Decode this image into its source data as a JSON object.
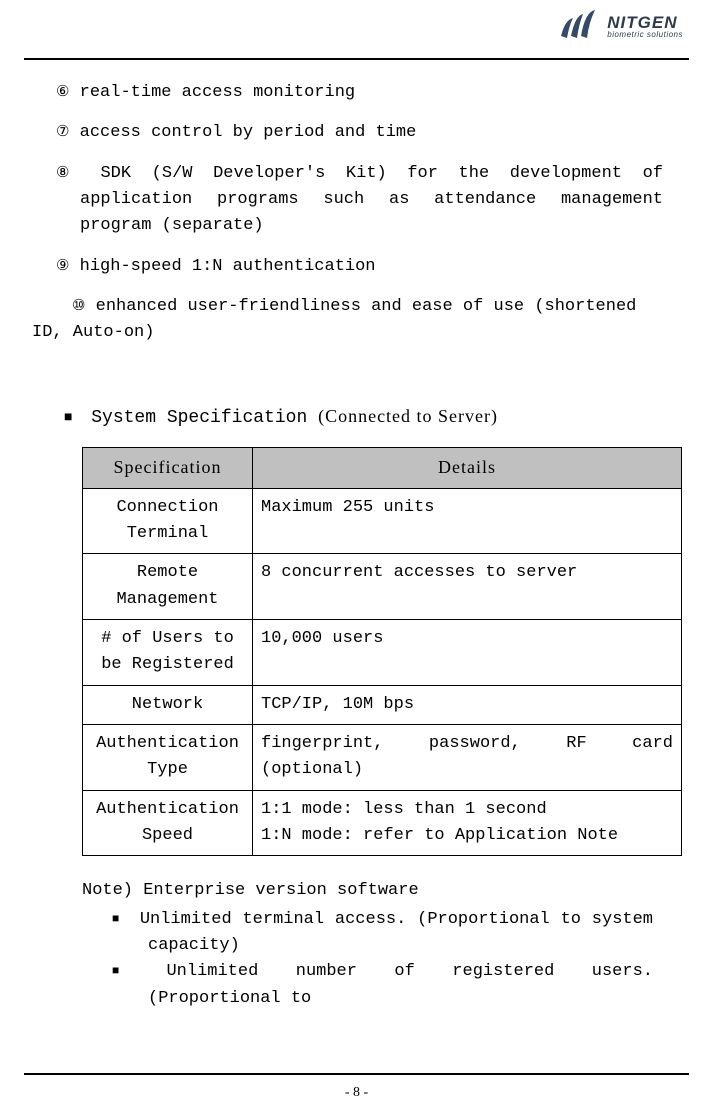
{
  "brand": {
    "name": "NITGEN",
    "tagline": "biometric solutions"
  },
  "features": {
    "f6": {
      "num": "⑥",
      "text": "real-time access monitoring"
    },
    "f7": {
      "num": "⑦",
      "text": "access control by period and time"
    },
    "f8": {
      "num": "⑧",
      "text": "SDK (S/W Developer's Kit) for the development of application programs such as attendance management program (separate)"
    },
    "f9": {
      "num": "⑨",
      "text": "high-speed 1:N authentication"
    },
    "f10": {
      "num": "⑩",
      "text": "enhanced user-friendliness and ease of use (shortened ID, Auto-on)"
    }
  },
  "section": {
    "bullet": "■",
    "title_plain": "System Specification",
    "title_fancy": "(Connected to Server)"
  },
  "table": {
    "header_spec": "Specification",
    "header_details": "Details",
    "rows": {
      "r0": {
        "spec": "Connection Terminal",
        "det": "Maximum 255 units"
      },
      "r1": {
        "spec": "Remote Management",
        "det": "8 concurrent accesses to server"
      },
      "r2": {
        "spec": "# of Users to be Registered",
        "det": "10,000 users"
      },
      "r3": {
        "spec": "Network",
        "det": "TCP/IP, 10M bps"
      },
      "r4": {
        "spec": "Authentication Type",
        "det": "fingerprint, password, RF card (optional)"
      },
      "r5": {
        "spec": "Authentication Speed",
        "det": "1:1 mode: less than 1 second\n1:N mode: refer to Application Note"
      }
    }
  },
  "note": {
    "title": "Note) Enterprise version software",
    "bullet": "■",
    "b1": "Unlimited terminal access. (Proportional to system capacity)",
    "b2": "Unlimited number of registered users. (Proportional to"
  },
  "page_number": "- 8 -"
}
